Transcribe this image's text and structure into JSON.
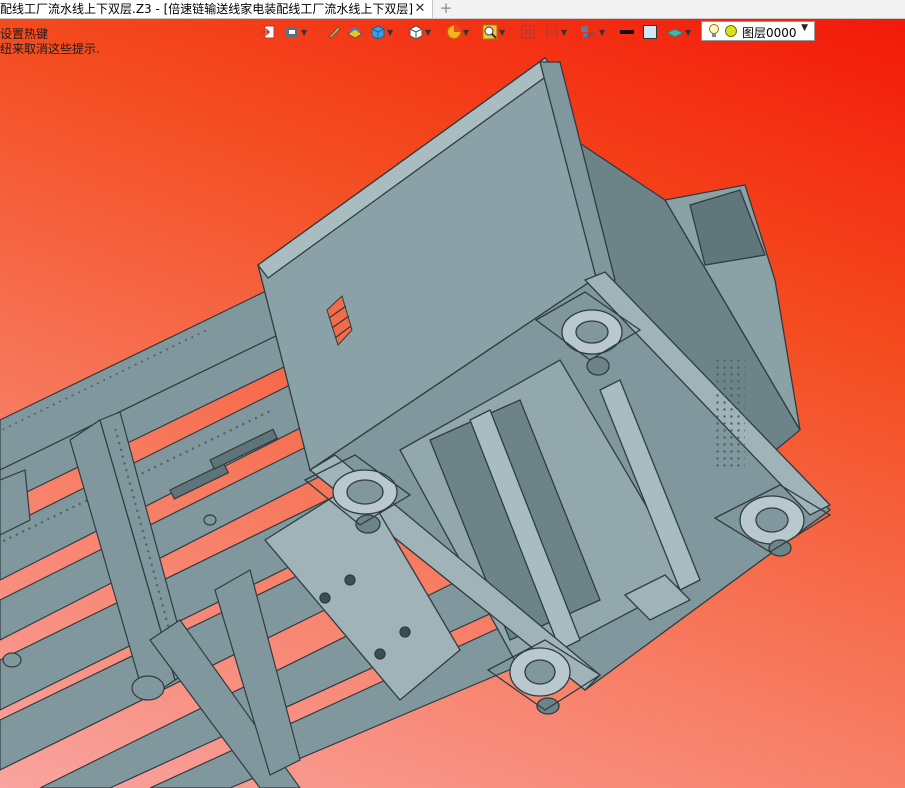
{
  "window": {
    "tab_title": "配线工厂流水线上下双层.Z3 - [倍速链输送线家电装配线工厂流水线上下双层]",
    "close_glyph": "✕",
    "new_tab_glyph": "+"
  },
  "hints": {
    "line1": "设置热键",
    "line2": "纽来取消这些提示."
  },
  "toolbar": {
    "icons": [
      "exit-icon",
      "view-filter-icon",
      "pen-icon",
      "render-style-icon",
      "solid-box-icon",
      "view-cube-icon",
      "pie-color-icon",
      "zoom-icon",
      "fit-view-icon",
      "section-icon",
      "assembly-icon",
      "line-style-icon",
      "color-swatch-icon",
      "layer-style-icon"
    ],
    "layer": {
      "value": "图层0000",
      "icons": [
        "lightbulb-icon",
        "layer-status-icon"
      ]
    }
  },
  "colors": {
    "bg_top": "#f3190a",
    "bg_bottom": "#f9a4a0",
    "model_gray": "#7f979d"
  }
}
